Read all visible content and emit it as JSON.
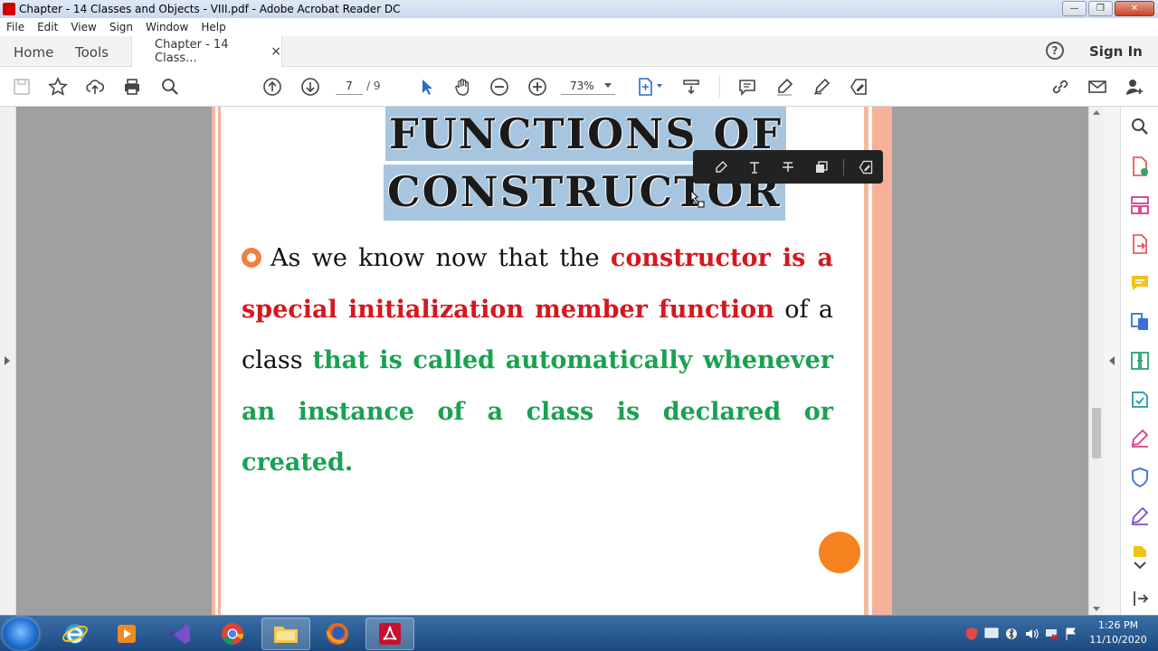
{
  "window": {
    "title": "Chapter - 14 Classes and Objects - VIII.pdf - Adobe Acrobat Reader DC",
    "controls": {
      "minimize": "—",
      "maximize": "❐",
      "close": "✕"
    }
  },
  "menu": [
    "File",
    "Edit",
    "View",
    "Sign",
    "Window",
    "Help"
  ],
  "tabs": {
    "home": "Home",
    "tools": "Tools",
    "document": "Chapter - 14 Class...",
    "close": "×"
  },
  "header": {
    "help": "?",
    "signin": "Sign In"
  },
  "toolbar": {
    "current_page": "7",
    "total_pages": "/ 9",
    "zoom": "73%"
  },
  "document": {
    "title_line1": "FUNCTIONS OF",
    "title_line2": "CONSTRUCTOR",
    "paragraph": {
      "intro": "As we know now that the ",
      "red1": "constructor is a special initialization member function",
      "middle": " of a class ",
      "green": "that is called automatically whenever an instance of a class is declared or created."
    }
  },
  "taskbar": {
    "time": "1:26 PM",
    "date": "11/10/2020"
  },
  "colors": {
    "highlight": "#a7c5de",
    "red_text": "#d4181f",
    "green_text": "#1aa152",
    "accent_orange": "#f5821f",
    "page_border": "#f6b79e"
  }
}
